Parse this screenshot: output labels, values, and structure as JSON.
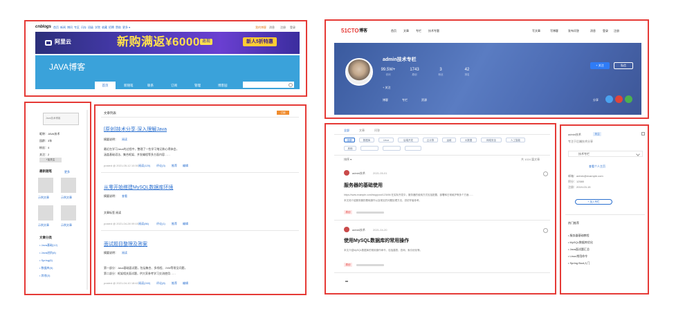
{
  "cnblogs": {
    "logo": "cnblogs",
    "nav": [
      "首页",
      "新闻",
      "博问",
      "专区",
      "闪存",
      "班级",
      "学院",
      "收藏",
      "招聘",
      "赞助",
      "更多 ▾"
    ],
    "topright": [
      "我的博客",
      "消息",
      "注册",
      "登录"
    ],
    "ad": {
      "brand": "阿里云",
      "text": "新购满返¥6000",
      "badge": "返现",
      "cta": "新人5折特惠"
    },
    "blog_title": "JAVA博客",
    "tabs": [
      "首页",
      "新随笔",
      "联系",
      "订阅",
      "管理",
      "博客园"
    ],
    "search_placeholder": "",
    "side": {
      "avatar_alt": "Java技术博客",
      "fields": [
        "昵称：JAVA技术",
        "园龄：3年",
        "粉丝：4",
        "关注：2"
      ],
      "follow": "+加关注",
      "recent_title": "最新随笔",
      "recent_more": "更多",
      "thumb_links": [
        "示例文章",
        "示例文章",
        "示例文章",
        "示例文章"
      ],
      "cat_title": "文章分类",
      "cats": [
        "Java基础(12)",
        "Java进阶(8)",
        "Spring(6)",
        "数据库(5)",
        "其他(3)"
      ]
    },
    "main": {
      "header": "文章列表",
      "header_badge": "订阅",
      "posts": [
        {
          "title": "[原创]技术分享·深入理解Java",
          "meta_label": "摘要说明：",
          "meta_link": "阅读",
          "summary": [
            "最近在学习Java的过程中，整理了一些学习笔记和心得体会，",
            "涵盖基础语法、集合框架、并发编程等多方面内容……"
          ],
          "footer": "posted @ 2021-05-12 10:30",
          "links": [
            "阅读(120)",
            "评论(3)",
            "推荐",
            "编辑"
          ]
        },
        {
          "title": "从零开始搭建MySQL数据库环境",
          "meta_label": "摘要说明：",
          "meta_link": "查看",
          "extra": "文章标签  阅读",
          "summary": [],
          "footer": "posted @ 2021-04-28 09:15",
          "links": [
            "阅读(86)",
            "评论(1)",
            "推荐",
            "编辑"
          ]
        },
        {
          "title": "面试题目整理及答案",
          "meta_label": "摘要说明：",
          "meta_link": "阅读",
          "summary": [
            "第一部分：Java基础面试题，包括集合、多线程、JVM等常见问题，",
            "第二部分：框架相关面试题，供大家参考学习交流使用……"
          ],
          "footer": "posted @ 2021-04-10 18:42",
          "links": [
            "阅读(240)",
            "评论(8)",
            "推荐",
            "编辑"
          ]
        }
      ]
    }
  },
  "cto": {
    "logo": "51CTO",
    "logo_sub": "博客",
    "nav": [
      "首页",
      "文章",
      "专栏",
      "技术专题"
    ],
    "right": [
      "写文章",
      "写博客",
      "发布问答",
      "消息",
      "登录",
      "注册"
    ],
    "profile": {
      "name": "admin技术专栏",
      "stats": [
        {
          "n": "99.5W+",
          "l": "访问"
        },
        {
          "n": "1743",
          "l": "原创"
        },
        {
          "n": "3",
          "l": "粉丝"
        },
        {
          "n": "42",
          "l": "排名"
        }
      ],
      "line2": "+ 关注",
      "links": [
        "博客",
        "专栏",
        "资源"
      ],
      "btn_follow": "+ 关注",
      "btn_msg": "私信",
      "share": "分享"
    },
    "tabs": [
      "全部",
      "文章",
      "问答"
    ],
    "tags": [
      "全部",
      "数据库",
      "Linux",
      "后端开发",
      "云计算",
      "运维",
      "大数据",
      "网络安全",
      "人工智能",
      "其他"
    ],
    "sort": "排序 ▾",
    "sort_right": "共 1024 篇文章",
    "posts": [
      {
        "author": "admin技术",
        "time": "2021-05-01",
        "title": "服务器的基础使用",
        "summary": [
          "https://www.example.com/blog/post/123456 在实际开发中，服务器的使用方式包括配置、部署和日常维护等多个方面……",
          "本文将介绍服务器的基础操作以及常见的问题处理方法，供初学者参考。"
        ],
        "badge": "原创"
      },
      {
        "author": "admin技术",
        "time": "2021-04-20",
        "title": "使用MySQL数据库的常用操作",
        "summary": [
          "本文介绍MySQL数据库的常用操作命令，包括建表、查询、索引优化等。"
        ],
        "badge": "原创"
      }
    ],
    "side": {
      "user": "admin技术",
      "badge": "关注",
      "desc": "专注于后端技术分享",
      "row": "技术专栏",
      "link": "查看个人主页",
      "info": [
        "邮箱：admin@example.com",
        "积分：12580",
        "注册：2019-03-15"
      ],
      "btn": "+ 加入专栏",
      "list_title": "热门推荐",
      "list": [
        "服务器基础教程",
        "MySQL数据库优化",
        "Java面试题汇总",
        "Linux常用命令",
        "Spring Boot入门"
      ]
    }
  }
}
